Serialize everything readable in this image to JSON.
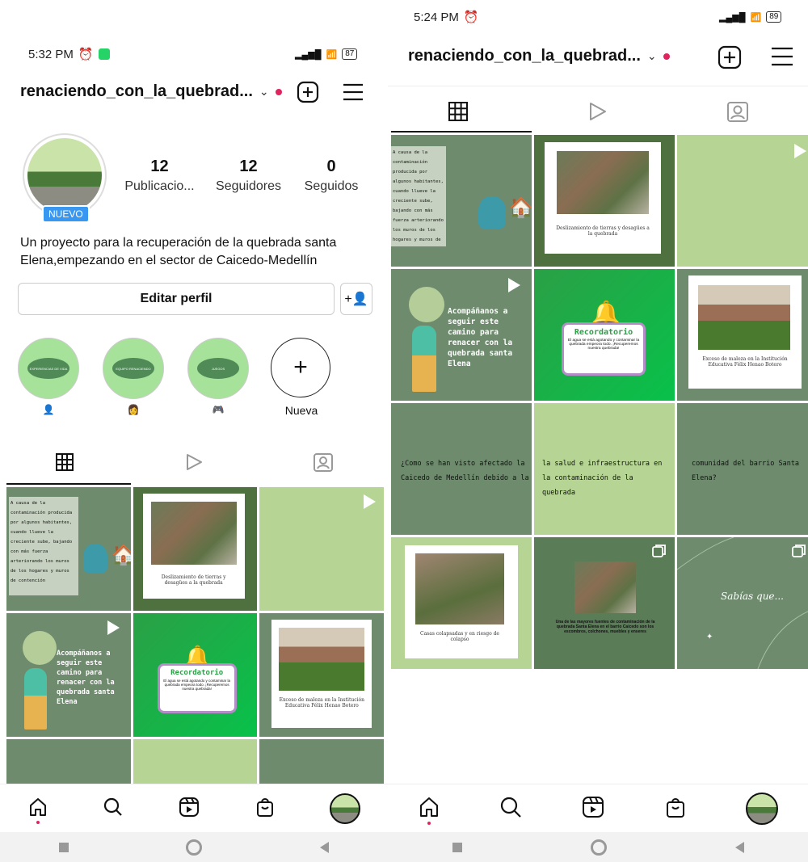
{
  "left": {
    "status_time": "5:32 PM",
    "battery": "87",
    "username": "renaciendo_con_la_quebrad...",
    "stats": [
      {
        "value": "12",
        "label": "Publicacio..."
      },
      {
        "value": "12",
        "label": "Seguidores"
      },
      {
        "value": "0",
        "label": "Seguidos"
      }
    ],
    "new_badge": "NUEVO",
    "bio": "Un proyecto para la recuperación de la quebrada santa Elena,empezando en el sector de Caicedo-Medellín",
    "edit_profile": "Editar perfil",
    "highlights": [
      {
        "inner": "EXPERIENCIAS DE VIDA",
        "label": "👤",
        "icon": "person-icon"
      },
      {
        "inner": "EQUIPO RENACIENDO",
        "label": "👩",
        "icon": "woman-icon"
      },
      {
        "inner": "JUEGOS",
        "label": "🎮",
        "icon": "gamepad-icon"
      }
    ],
    "new_highlight": "Nueva"
  },
  "right": {
    "status_time": "5:24 PM",
    "battery": "89",
    "username": "renaciendo_con_la_quebrad..."
  },
  "posts": {
    "contaminacion_text": "A causa de la contaminación producida por algunos habitantes, cuando llueve la creciente sube, bajando con más fuerza arteriorando los muros de los hogares y muros de contención",
    "deslizamiento_caption": "Deslizamiento de tierras y desagües a la quebrada",
    "acompananos_text": "Acompáñanos a seguir este camino para renacer con la quebrada santa Elena",
    "recordatorio_title": "Recordatorio",
    "recordatorio_body": "El agua se está agotando y contaminar la quebrada empeora todo. ¡Recuperemos nuestra quebrada!",
    "maleza_caption": "Exceso de maleza en la Institución Educativa Félix Henao Botero",
    "q1": "¿Como se han visto afectado la Caicedo de Medellín debido a la",
    "q2": "la salud e infraestructura en la contaminación de la quebrada",
    "q3": "comunidad del barrio Santa Elena?",
    "casas_caption": "Casas colapsadas y en riesgo de colapso",
    "fuentes_caption": "Una de las mayores fuentes de contaminación de la quebrada Santa Elena en el barrio Caicedo son los escombros, colchones, muebles y enseres",
    "sabias": "Sabías que..."
  },
  "colors": {
    "sage": "#6e8b6e",
    "sage_dark": "#5a7d58",
    "lime": "#b6d595",
    "green_bright": "#23b04e",
    "accent_red": "#e0245e"
  }
}
